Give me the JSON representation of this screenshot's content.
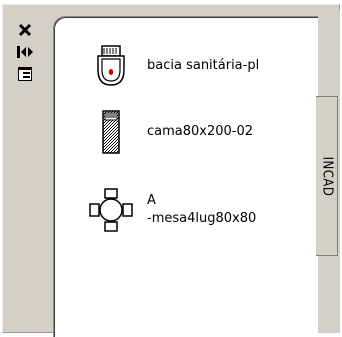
{
  "palette": {
    "title_buttons": [
      {
        "icon": "close-icon",
        "label": "×"
      },
      {
        "icon": "autohide-icon"
      },
      {
        "icon": "properties-icon"
      }
    ],
    "tab_label": "INCAD",
    "items": [
      {
        "icon": "toilet-block-icon",
        "name": "bacia sanitária-pl"
      },
      {
        "icon": "bed-block-icon",
        "name": "cama80x200-02"
      },
      {
        "icon": "table-block-icon",
        "name_line1": "A",
        "name_line2": "-mesa4lug80x80"
      }
    ]
  }
}
